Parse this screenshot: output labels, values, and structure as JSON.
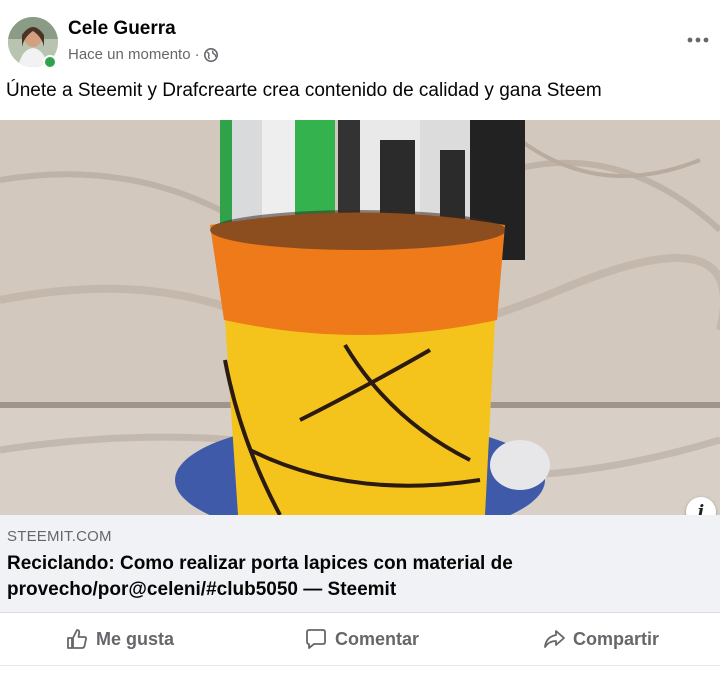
{
  "post": {
    "author": "Cele Guerra",
    "timestamp": "Hace un momento",
    "separator": "·",
    "privacy_icon": "globe-icon",
    "more_icon": "more-dots-icon",
    "caption": "Únete a Steemit y Drafcrearte crea contenido de calidad y gana Steem"
  },
  "link_preview": {
    "domain": "STEEMIT.COM",
    "title": "Reciclando: Como realizar porta lapices con material de provecho/por@celeni/#club5050 — Steemit",
    "info_icon_label": "i"
  },
  "actions": {
    "like": "Me gusta",
    "comment": "Comentar",
    "share": "Compartir"
  },
  "colors": {
    "text_secondary": "#65676b",
    "link_bg": "#f0f2f5",
    "online": "#31a24c"
  }
}
